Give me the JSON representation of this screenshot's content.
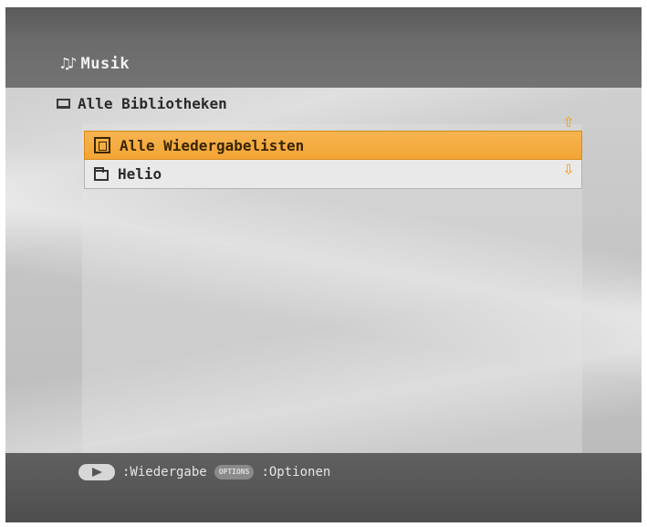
{
  "header": {
    "title": "Musik",
    "icon": "music-notes-icon"
  },
  "breadcrumb": {
    "label": "Alle Bibliotheken",
    "icon": "monitor-icon"
  },
  "list": {
    "items": [
      {
        "label": "Alle Wiedergabelisten",
        "icon": "playlist-icon",
        "selected": true
      },
      {
        "label": "Helio",
        "icon": "folder-icon",
        "selected": false
      }
    ]
  },
  "footer": {
    "play_hint": ":Wiedergabe",
    "options_button": "OPTIONS",
    "options_hint": ":Optionen"
  },
  "colors": {
    "selection": "#f3a535",
    "arrow": "#f1a737",
    "header_bg": "#636363"
  }
}
